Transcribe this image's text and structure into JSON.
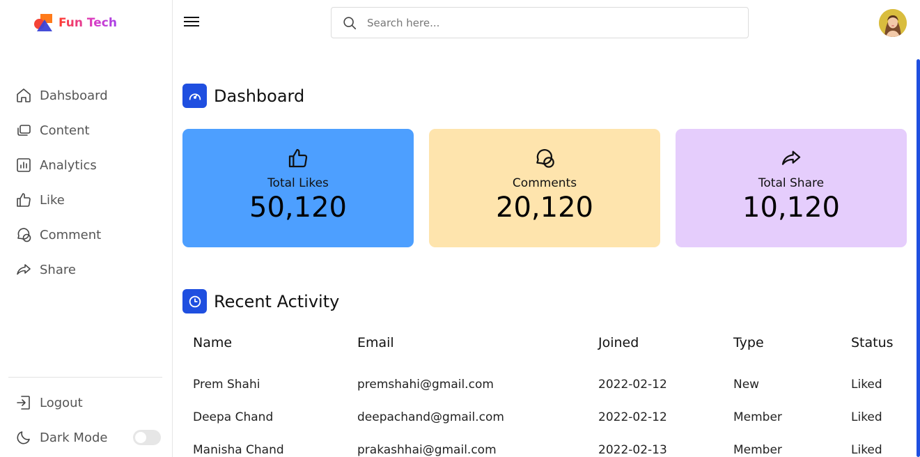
{
  "brand": {
    "name": "Fun Tech"
  },
  "sidebar": {
    "items": [
      {
        "label": "Dahsboard",
        "icon": "home-icon"
      },
      {
        "label": "Content",
        "icon": "content-icon"
      },
      {
        "label": "Analytics",
        "icon": "analytics-icon"
      },
      {
        "label": "Like",
        "icon": "thumbs-up-icon"
      },
      {
        "label": "Comment",
        "icon": "comment-icon"
      },
      {
        "label": "Share",
        "icon": "share-icon"
      }
    ],
    "logout_label": "Logout",
    "dark_mode_label": "Dark Mode",
    "dark_mode_on": false
  },
  "header": {
    "search_placeholder": "Search here..."
  },
  "dashboard": {
    "title": "Dashboard",
    "cards": [
      {
        "label": "Total Likes",
        "value": "50,120",
        "color": "#4d9fff",
        "icon": "thumbs-up-icon"
      },
      {
        "label": "Comments",
        "value": "20,120",
        "color": "#fee4ad",
        "icon": "comment-icon"
      },
      {
        "label": "Total Share",
        "value": "10,120",
        "color": "#e5cdfc",
        "icon": "share-icon"
      }
    ]
  },
  "activity": {
    "title": "Recent Activity",
    "columns": [
      "Name",
      "Email",
      "Joined",
      "Type",
      "Status"
    ],
    "rows": [
      [
        "Prem Shahi",
        "premshahi@gmail.com",
        "2022-02-12",
        "New",
        "Liked"
      ],
      [
        "Deepa Chand",
        "deepachand@gmail.com",
        "2022-02-12",
        "Member",
        "Liked"
      ],
      [
        "Manisha Chand",
        "prakashhai@gmail.com",
        "2022-02-13",
        "Member",
        "Liked"
      ]
    ]
  },
  "colors": {
    "accent": "#1f4fe0"
  }
}
